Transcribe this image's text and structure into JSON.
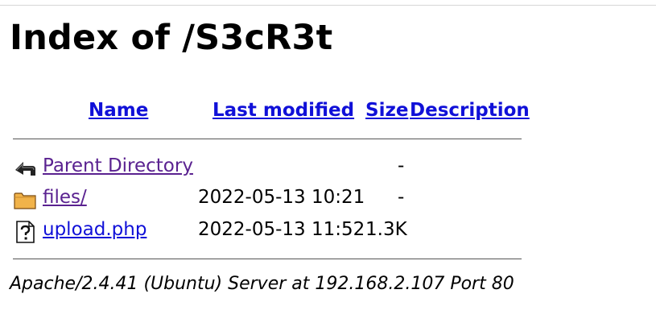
{
  "page": {
    "title": "Index of /S3cR3t"
  },
  "table": {
    "headers": {
      "name": "Name",
      "last_modified": "Last modified",
      "size": "Size",
      "description": "Description"
    },
    "rows": [
      {
        "icon": "back-arrow-icon",
        "name": "Parent Directory",
        "last_modified": "",
        "size": "-",
        "description": ""
      },
      {
        "icon": "folder-icon",
        "name": "files/",
        "last_modified": "2022-05-13 10:21",
        "size": "-",
        "description": ""
      },
      {
        "icon": "unknown-file-icon",
        "name": "upload.php",
        "last_modified": "2022-05-13 11:52",
        "size": "1.3K",
        "description": ""
      }
    ]
  },
  "footer": {
    "address": "Apache/2.4.41 (Ubuntu) Server at 192.168.2.107 Port 80"
  },
  "colors": {
    "link": "#1010d8",
    "visited_link": "#5a2290",
    "folder": "#f1b34a"
  }
}
